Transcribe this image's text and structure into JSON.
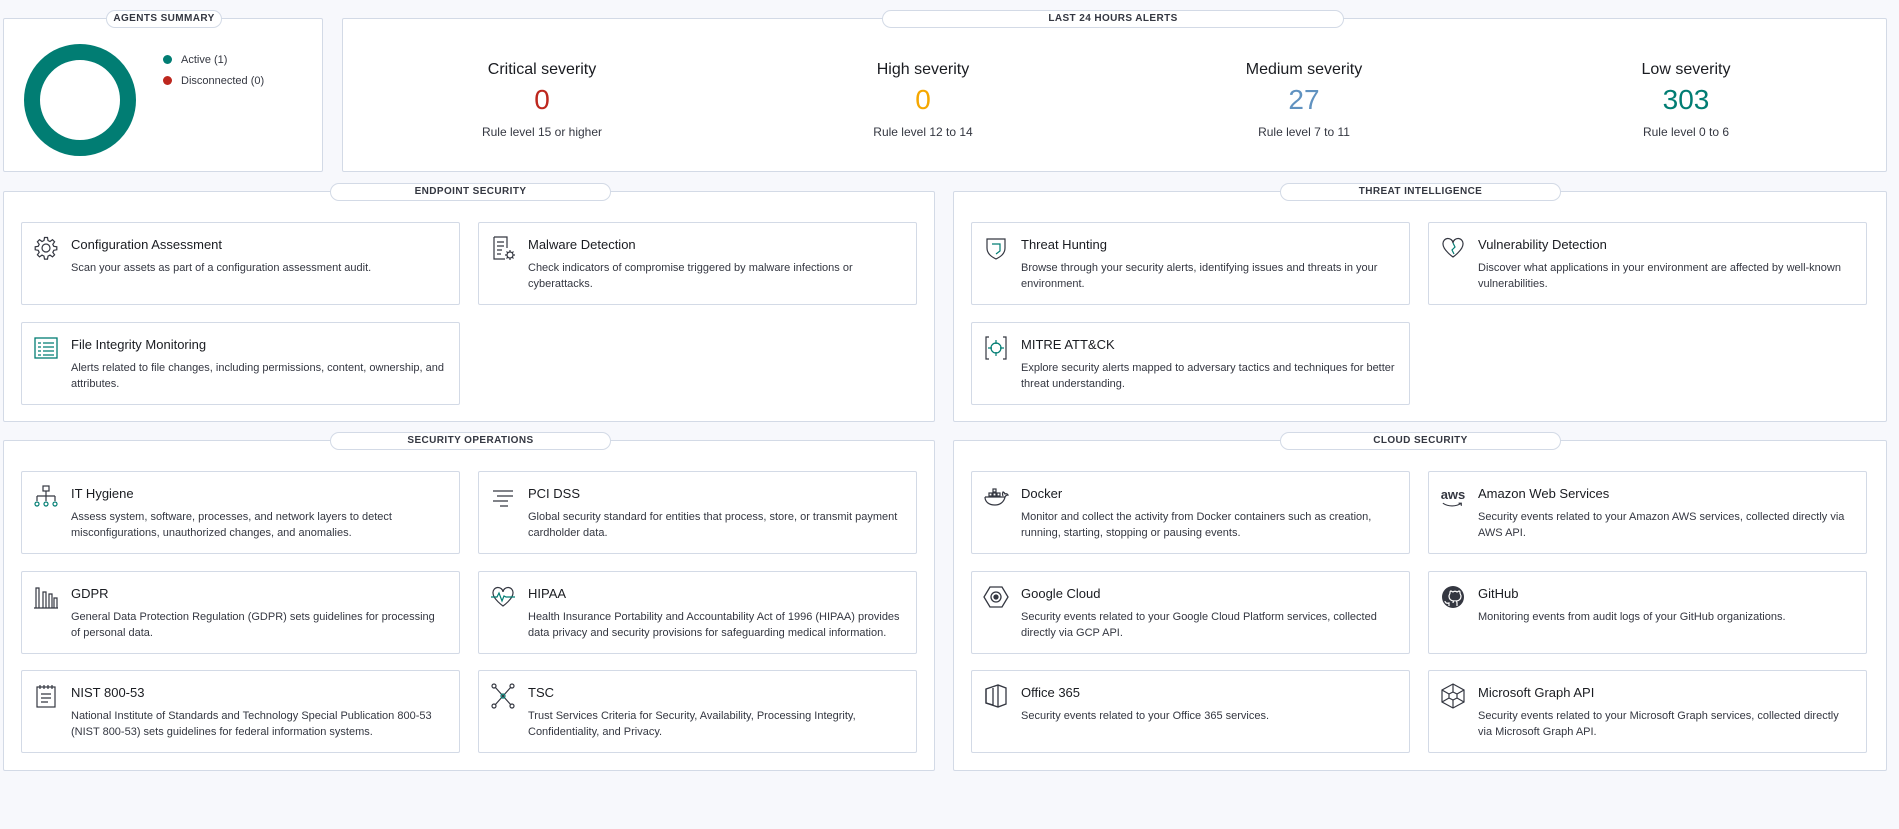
{
  "agents_summary": {
    "title": "AGENTS SUMMARY",
    "legend": [
      {
        "label": "Active (1)",
        "color": "#017d73"
      },
      {
        "label": "Disconnected (0)",
        "color": "#bd271e"
      }
    ],
    "donut_color": "#017d73"
  },
  "alerts": {
    "title": "LAST 24 HOURS ALERTS",
    "severities": [
      {
        "title": "Critical severity",
        "count": "0",
        "rule": "Rule level 15 or higher",
        "color": "#bd271e"
      },
      {
        "title": "High severity",
        "count": "0",
        "rule": "Rule level 12 to 14",
        "color": "#f5a700"
      },
      {
        "title": "Medium severity",
        "count": "27",
        "rule": "Rule level 7 to 11",
        "color": "#6092c0"
      },
      {
        "title": "Low severity",
        "count": "303",
        "rule": "Rule level 0 to 6",
        "color": "#017d73"
      }
    ]
  },
  "endpoint_security": {
    "title": "ENDPOINT SECURITY",
    "cards": [
      {
        "icon": "gear-icon",
        "title": "Configuration Assessment",
        "desc": "Scan your assets as part of a configuration assessment audit."
      },
      {
        "icon": "malware-document-icon",
        "title": "Malware Detection",
        "desc": "Check indicators of compromise triggered by malware infections or cyberattacks."
      },
      {
        "icon": "file-list-icon",
        "title": "File Integrity Monitoring",
        "desc": "Alerts related to file changes, including permissions, content, ownership, and attributes."
      }
    ]
  },
  "threat_intelligence": {
    "title": "THREAT INTELLIGENCE",
    "cards": [
      {
        "icon": "shield-icon",
        "title": "Threat Hunting",
        "desc": "Browse through your security alerts, identifying issues and threats in your environment."
      },
      {
        "icon": "heart-icon",
        "title": "Vulnerability Detection",
        "desc": "Discover what applications in your environment are affected by well-known vulnerabilities."
      },
      {
        "icon": "crosshair-icon",
        "title": "MITRE ATT&CK",
        "desc": "Explore security alerts mapped to adversary tactics and techniques for better threat understanding."
      }
    ]
  },
  "security_operations": {
    "title": "SECURITY OPERATIONS",
    "cards": [
      {
        "icon": "hierarchy-icon",
        "title": "IT Hygiene",
        "desc": "Assess system, software, processes, and network layers to detect misconfigurations, unauthorized changes, and anomalies."
      },
      {
        "icon": "lines-icon",
        "title": "PCI DSS",
        "desc": "Global security standard for entities that process, store, or transmit payment cardholder data."
      },
      {
        "icon": "building-icon",
        "title": "GDPR",
        "desc": "General Data Protection Regulation (GDPR) sets guidelines for processing of personal data."
      },
      {
        "icon": "heartbeat-icon",
        "title": "HIPAA",
        "desc": "Health Insurance Portability and Accountability Act of 1996 (HIPAA) provides data privacy and security provisions for safeguarding medical information."
      },
      {
        "icon": "notepad-icon",
        "title": "NIST 800-53",
        "desc": "National Institute of Standards and Technology Special Publication 800-53 (NIST 800-53) sets guidelines for federal information systems."
      },
      {
        "icon": "network-icon",
        "title": "TSC",
        "desc": "Trust Services Criteria for Security, Availability, Processing Integrity, Confidentiality, and Privacy."
      }
    ]
  },
  "cloud_security": {
    "title": "CLOUD SECURITY",
    "cards": [
      {
        "icon": "docker-icon",
        "title": "Docker",
        "desc": "Monitor and collect the activity from Docker containers such as creation, running, starting, stopping or pausing events."
      },
      {
        "icon": "aws-icon",
        "title": "Amazon Web Services",
        "desc": "Security events related to your Amazon AWS services, collected directly via AWS API.",
        "icon_text": "aws"
      },
      {
        "icon": "google-cloud-icon",
        "title": "Google Cloud",
        "desc": "Security events related to your Google Cloud Platform services, collected directly via GCP API."
      },
      {
        "icon": "github-icon",
        "title": "GitHub",
        "desc": "Monitoring events from audit logs of your GitHub organizations."
      },
      {
        "icon": "office-icon",
        "title": "Office 365",
        "desc": "Security events related to your Office 365 services."
      },
      {
        "icon": "graph-icon",
        "title": "Microsoft Graph API",
        "desc": "Security events related to your Microsoft Graph services, collected directly via Microsoft Graph API."
      }
    ]
  }
}
